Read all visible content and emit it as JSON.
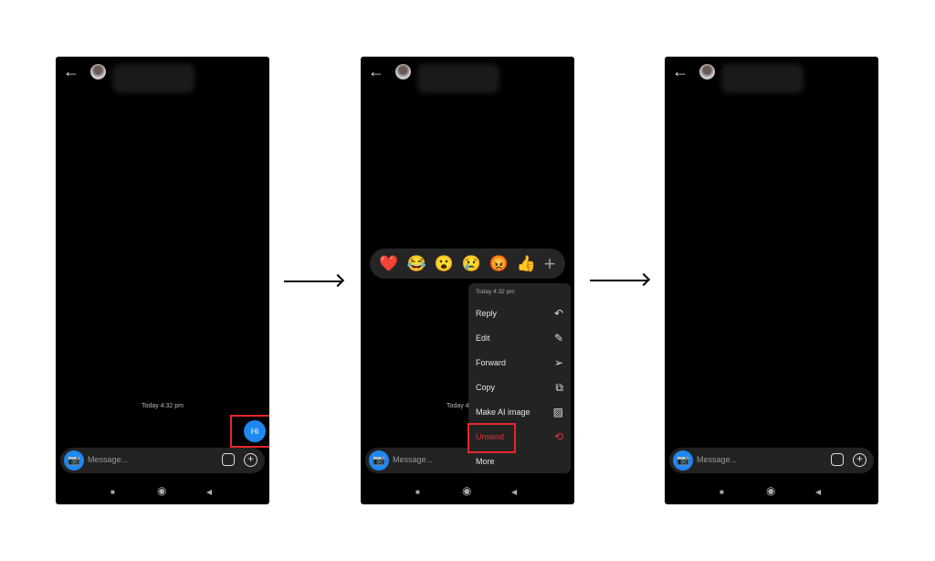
{
  "chat": {
    "timestamp": "Today 4:32 pm",
    "placeholder": "Message...",
    "message": "Hi"
  },
  "icons": {
    "back": "←",
    "camera": "📷",
    "nav_square": "■",
    "nav_home": "◉",
    "nav_back": "◀"
  },
  "reactions": [
    "❤️",
    "😂",
    "😮",
    "😢",
    "😡",
    "👍",
    "+"
  ],
  "menu": {
    "timestamp": "Today 4:32 pm",
    "items": [
      {
        "label": "Reply",
        "icon": "↶"
      },
      {
        "label": "Edit",
        "icon": "✎"
      },
      {
        "label": "Forward",
        "icon": "➢"
      },
      {
        "label": "Copy",
        "icon": "⧉"
      },
      {
        "label": "Make AI image",
        "icon": "▨"
      },
      {
        "label": "Unsend",
        "icon": "⟲"
      },
      {
        "label": "More",
        "icon": ""
      }
    ]
  },
  "colors": {
    "accent": "#1e88f0",
    "highlight": "#e8262c",
    "danger": "#e0323c"
  }
}
